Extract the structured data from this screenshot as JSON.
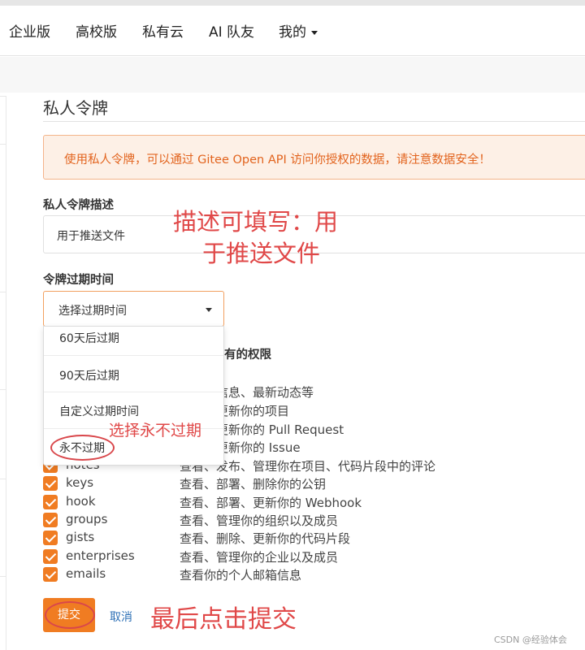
{
  "nav": {
    "items": [
      {
        "label": "企业版"
      },
      {
        "label": "高校版"
      },
      {
        "label": "私有云"
      },
      {
        "label": "AI 队友"
      },
      {
        "label": "我的"
      }
    ]
  },
  "page": {
    "title": "私人令牌",
    "alert": "使用私人令牌，可以通过 Gitee Open API 访问你授权的数据，请注意数据安全！"
  },
  "form": {
    "desc_label": "私人令牌描述",
    "desc_value": "用于推送文件",
    "expire_label": "令牌过期时间",
    "expire_select": "选择过期时间",
    "expire_options": [
      "60天后过期",
      "90天后过期",
      "自定义过期时间",
      "永不过期"
    ],
    "perm_header_partial": "有的权限",
    "permissions": [
      {
        "name": "",
        "desc": "的个人信息、最新动态等"
      },
      {
        "name": "",
        "desc": "创建、更新你的项目"
      },
      {
        "name": "",
        "desc": "发布、更新你的 Pull Request"
      },
      {
        "name": "",
        "desc": "发布、更新你的 Issue"
      },
      {
        "name": "notes",
        "desc": "查看、发布、管理你在项目、代码片段中的评论"
      },
      {
        "name": "keys",
        "desc": "查看、部署、删除你的公钥"
      },
      {
        "name": "hook",
        "desc": "查看、部署、更新你的 Webhook"
      },
      {
        "name": "groups",
        "desc": "查看、管理你的组织以及成员"
      },
      {
        "name": "gists",
        "desc": "查看、删除、更新你的代码片段"
      },
      {
        "name": "enterprises",
        "desc": "查看、管理你的企业以及成员"
      },
      {
        "name": "emails",
        "desc": "查看你的个人邮箱信息"
      }
    ],
    "submit_label": "提交",
    "cancel_label": "取消"
  },
  "annotations": {
    "desc_note_line1": "描述可填写：用",
    "desc_note_line2": "于推送文件",
    "select_note": "选择永不过期",
    "submit_note": "最后点击提交",
    "color": "#e04848"
  },
  "watermark": "CSDN @经验体会",
  "colors": {
    "accent": "#f07c22",
    "alert_bg": "#fdf0e6",
    "alert_text": "#e2631d",
    "link": "#2c6fb5"
  }
}
